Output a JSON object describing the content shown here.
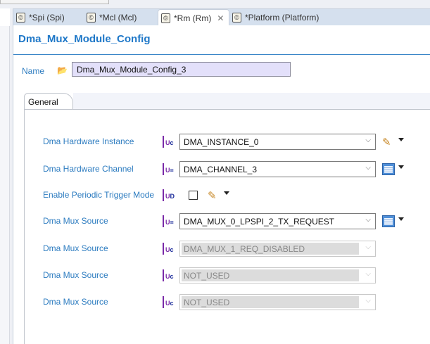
{
  "tabs": [
    {
      "label": "*Spi (Spi)",
      "active": false
    },
    {
      "label": "*Mcl (Mcl)",
      "active": false
    },
    {
      "label": "*Rm (Rm)",
      "active": true
    },
    {
      "label": "*Platform (Platform)",
      "active": false
    }
  ],
  "editor": {
    "title": "Dma_Mux_Module_Config",
    "name_label": "Name",
    "name_value": "Dma_Mux_Module_Config_3",
    "section_tab": "General"
  },
  "fields": [
    {
      "label": "Dma Hardware Instance",
      "value": "DMA_INSTANCE_0"
    },
    {
      "label": "Dma Hardware Channel",
      "value": "DMA_CHANNEL_3"
    },
    {
      "label": "Enable Periodic Trigger Mode",
      "checked": false
    },
    {
      "label": "Dma Mux Source",
      "value": "DMA_MUX_0_LPSPI_2_TX_REQUEST"
    },
    {
      "label": "Dma Mux Source",
      "value": "DMA_MUX_1_REQ_DISABLED",
      "disabled": true
    },
    {
      "label": "Dma Mux Source",
      "value": "NOT_USED",
      "disabled": true
    },
    {
      "label": "Dma Mux Source",
      "value": "NOT_USED",
      "disabled": true
    }
  ]
}
